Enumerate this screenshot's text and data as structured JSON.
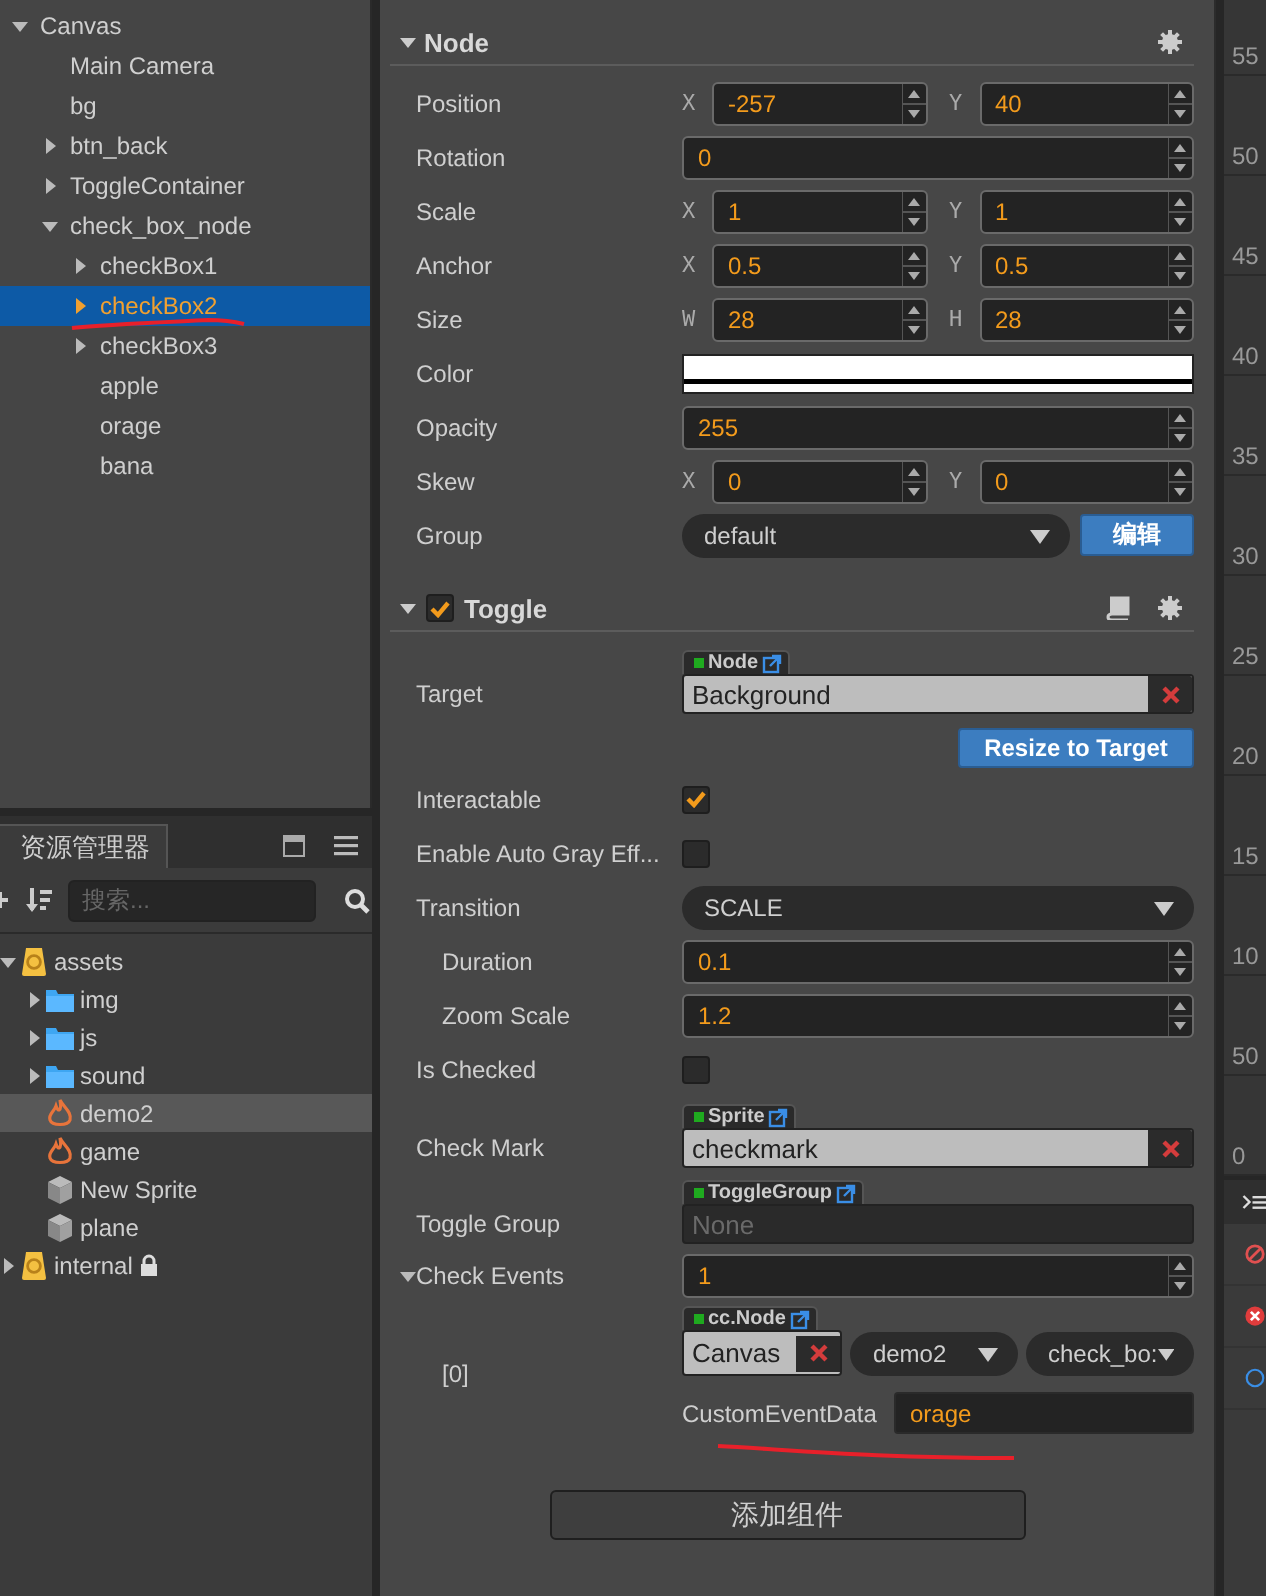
{
  "hierarchy": {
    "items": [
      {
        "label": "Canvas",
        "expanded": true,
        "selected": false,
        "children": [
          {
            "label": "Main Camera",
            "selected": false
          },
          {
            "label": "bg",
            "selected": false
          },
          {
            "label": "btn_back",
            "expanded": false,
            "selected": false
          },
          {
            "label": "ToggleContainer",
            "expanded": false,
            "selected": false
          },
          {
            "label": "check_box_node",
            "expanded": true,
            "selected": false,
            "children": [
              {
                "label": "checkBox1",
                "expanded": false,
                "selected": false
              },
              {
                "label": "checkBox2",
                "expanded": false,
                "selected": true
              },
              {
                "label": "checkBox3",
                "expanded": false,
                "selected": false
              },
              {
                "label": "apple",
                "selected": false
              },
              {
                "label": "orage",
                "selected": false
              },
              {
                "label": "bana",
                "selected": false
              }
            ]
          }
        ]
      }
    ]
  },
  "assets": {
    "tab": "资源管理器",
    "search": {
      "placeholder": "搜索..."
    },
    "items": [
      {
        "label": "assets",
        "kind": "root",
        "expanded": true,
        "selected": false,
        "children": [
          {
            "label": "img",
            "kind": "folder",
            "expanded": false,
            "selected": false
          },
          {
            "label": "js",
            "kind": "folder",
            "expanded": false,
            "selected": false
          },
          {
            "label": "sound",
            "kind": "folder",
            "expanded": false,
            "selected": false
          },
          {
            "label": "demo2",
            "kind": "scene",
            "selected": true
          },
          {
            "label": "game",
            "kind": "scene",
            "selected": false
          },
          {
            "label": "New Sprite",
            "kind": "prefab",
            "selected": false
          },
          {
            "label": "plane",
            "kind": "prefab",
            "selected": false
          }
        ]
      },
      {
        "label": "internal",
        "kind": "root",
        "expanded": false,
        "selected": false,
        "locked": true
      }
    ]
  },
  "inspector": {
    "components": [
      {
        "title": "Node",
        "expanded": true,
        "properties": [
          {
            "kind": "vector",
            "label": "Position",
            "fields": [
              {
                "axis": "X",
                "value": "-257"
              },
              {
                "axis": "Y",
                "value": "40"
              }
            ]
          },
          {
            "kind": "number",
            "label": "Rotation",
            "value": "0"
          },
          {
            "kind": "vector",
            "label": "Scale",
            "fields": [
              {
                "axis": "X",
                "value": "1"
              },
              {
                "axis": "Y",
                "value": "1"
              }
            ]
          },
          {
            "kind": "vector",
            "label": "Anchor",
            "fields": [
              {
                "axis": "X",
                "value": "0.5"
              },
              {
                "axis": "Y",
                "value": "0.5"
              }
            ]
          },
          {
            "kind": "vector",
            "label": "Size",
            "fields": [
              {
                "axis": "W",
                "value": "28"
              },
              {
                "axis": "H",
                "value": "28"
              }
            ]
          },
          {
            "kind": "color",
            "label": "Color",
            "color": "#ffffff"
          },
          {
            "kind": "number",
            "label": "Opacity",
            "value": "255"
          },
          {
            "kind": "vector",
            "label": "Skew",
            "fields": [
              {
                "axis": "X",
                "value": "0"
              },
              {
                "axis": "Y",
                "value": "0"
              }
            ]
          },
          {
            "kind": "select",
            "label": "Group",
            "value": "default",
            "button": "编辑"
          }
        ]
      },
      {
        "title": "Toggle",
        "enabled": true,
        "expanded": true,
        "properties": [
          {
            "kind": "ref",
            "label": "Target",
            "tag": "Node",
            "value": "Background"
          },
          {
            "kind": "action",
            "label": "Resize to Target"
          },
          {
            "kind": "checkbox",
            "label": "Interactable",
            "checked": true
          },
          {
            "kind": "checkbox",
            "label": "Enable Auto Gray Eff...",
            "checked": false
          },
          {
            "kind": "select",
            "label": "Transition",
            "value": "SCALE",
            "children": [
              {
                "kind": "number",
                "label": "Duration",
                "value": "0.1"
              },
              {
                "kind": "number",
                "label": "Zoom Scale",
                "value": "1.2"
              }
            ]
          },
          {
            "kind": "checkbox",
            "label": "Is Checked",
            "checked": false
          },
          {
            "kind": "ref",
            "label": "Check Mark",
            "tag": "Sprite",
            "value": "checkmark"
          },
          {
            "kind": "ref",
            "label": "Toggle Group",
            "tag": "ToggleGroup",
            "placeholder": "None"
          },
          {
            "kind": "number",
            "label": "Check Events",
            "value": "1",
            "expanded": true,
            "children": [
              {
                "kind": "event",
                "label": "[0]",
                "tag": "cc.Node",
                "target": "Canvas",
                "component": "demo2",
                "handler": "check_bo:",
                "data_label": "CustomEventData",
                "data_value": "orage"
              }
            ]
          }
        ]
      }
    ],
    "add_button": "添加组件"
  },
  "ruler": {
    "labels": [
      "55",
      "50",
      "45",
      "40",
      "35",
      "30",
      "25",
      "20",
      "15",
      "10",
      "50",
      "0"
    ]
  }
}
